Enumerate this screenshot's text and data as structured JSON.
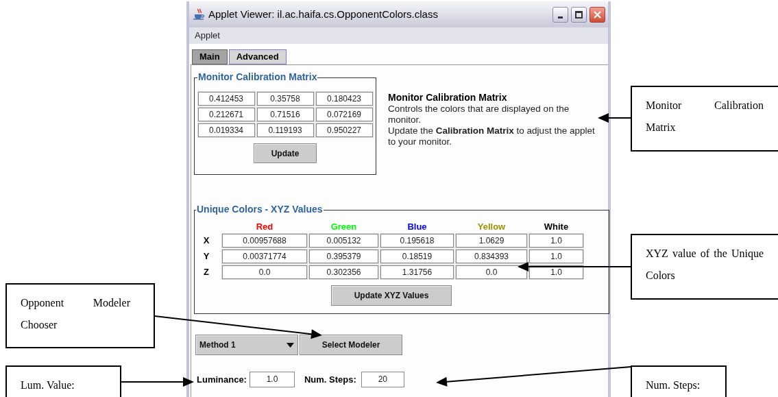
{
  "window": {
    "title": "Applet Viewer: il.ac.haifa.cs.OpponentColors.class"
  },
  "menu": [
    "Applet"
  ],
  "tabs": [
    {
      "label": "Main",
      "selected": true
    },
    {
      "label": "Advanced",
      "selected": false
    }
  ],
  "calibration": {
    "title": "Monitor Calibration Matrix",
    "matrix": [
      [
        "0.412453",
        "0.35758",
        "0.180423"
      ],
      [
        "0.212671",
        "0.71516",
        "0.072169"
      ],
      [
        "0.019334",
        "0.119193",
        "0.950227"
      ]
    ],
    "button": "Update"
  },
  "description": {
    "title": "Monitor Calibration Matrix",
    "paragraphs": [
      "Controls the colors that are displayed on the monitor.",
      "Update the **Calibration Matrix** to adjust the applet to your monitor."
    ]
  },
  "unique_colors": {
    "title": "Unique Colors - XYZ Values",
    "columns": [
      {
        "label": "Red",
        "color": "#ff0000"
      },
      {
        "label": "Green",
        "color": "#00ff00"
      },
      {
        "label": "Blue",
        "color": "#0000ff"
      },
      {
        "label": "Yellow",
        "color": "#9e9100"
      },
      {
        "label": "White",
        "color": "#000000"
      }
    ],
    "rows": [
      {
        "label": "X",
        "values": [
          "0.00957688",
          "0.005132",
          "0.195618",
          "1.0629",
          "1.0"
        ]
      },
      {
        "label": "Y",
        "values": [
          "0.00371774",
          "0.395379",
          "0.18519",
          "0.834393",
          "1.0"
        ]
      },
      {
        "label": "Z",
        "values": [
          "0.0",
          "0.302356",
          "1.31756",
          "0.0",
          "1.0"
        ]
      }
    ],
    "button": "Update XYZ Values"
  },
  "modeler": {
    "method": "Method 1",
    "button": "Select Modeler"
  },
  "luminance": {
    "label": "Luminance:",
    "value": "1.0"
  },
  "num_steps": {
    "label": "Num. Steps:",
    "value": "20"
  },
  "annotations": [
    {
      "text": "Monitor Calibration Matrix"
    },
    {
      "text": "XYZ value of the Unique Colors"
    },
    {
      "text": "Opponent Modeler Chooser"
    },
    {
      "text": "Lum. Value:"
    },
    {
      "text": "Num. Steps:"
    }
  ]
}
